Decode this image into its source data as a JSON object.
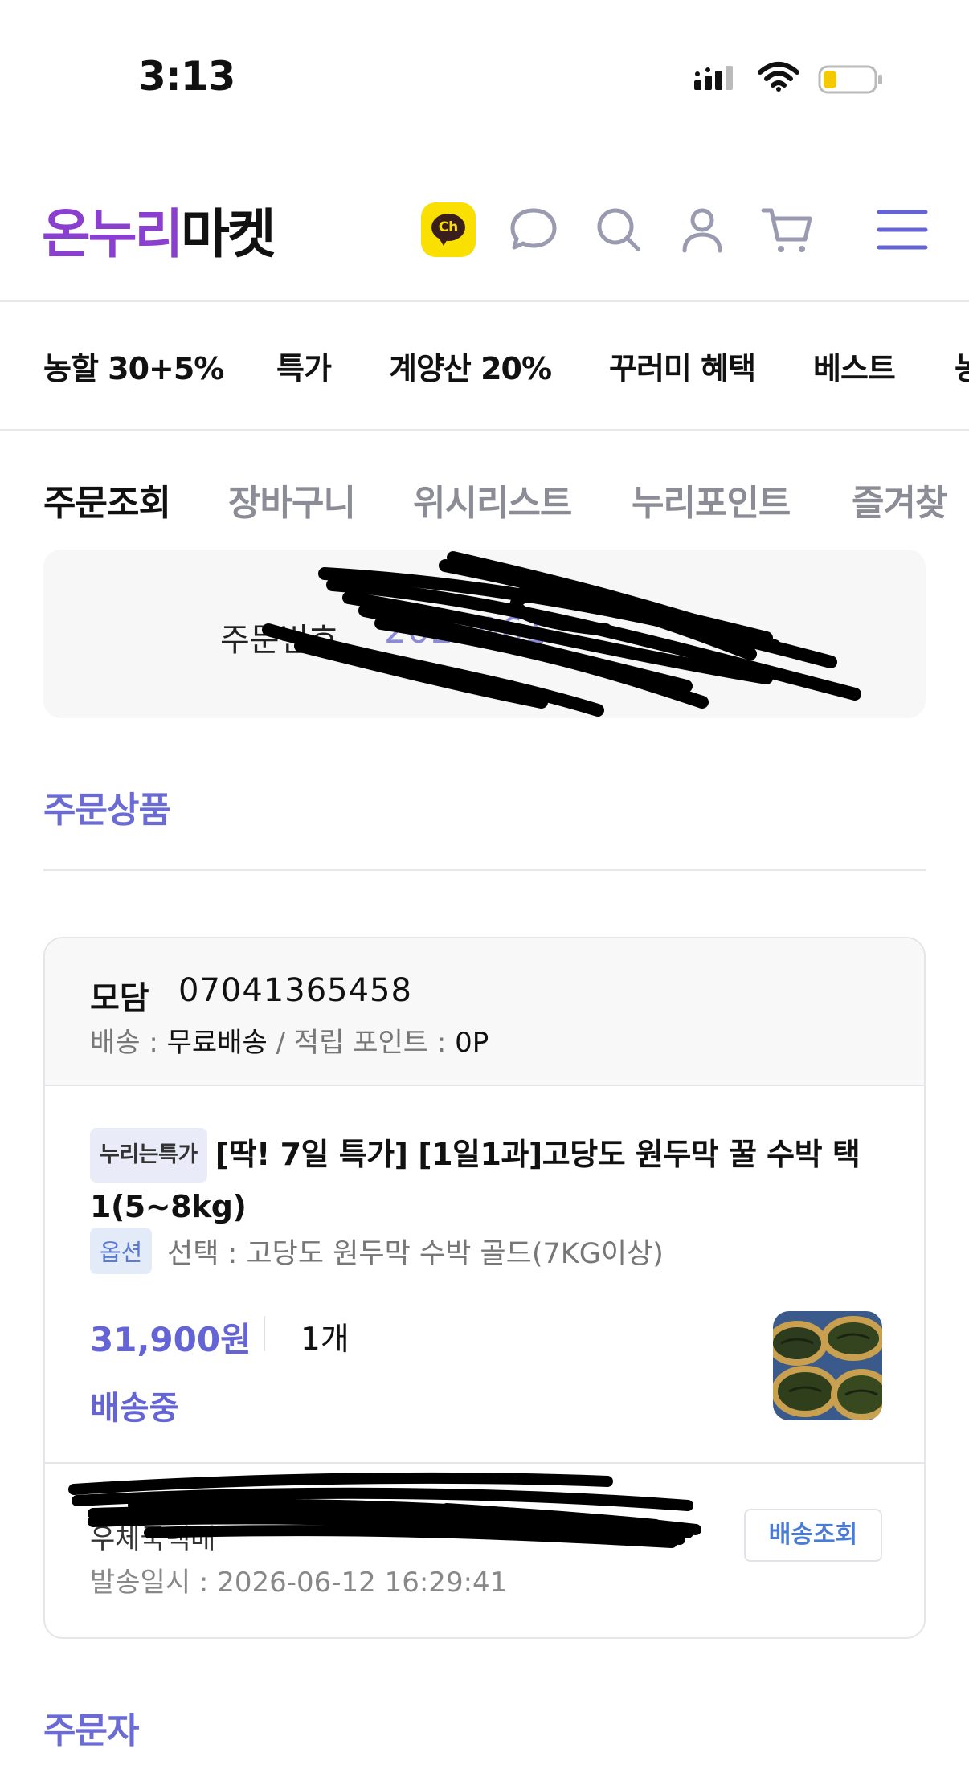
{
  "status_bar": {
    "time": "3:13"
  },
  "header": {
    "logo_part1": "온누리",
    "logo_part2": "마켓",
    "kakao_label": "Ch"
  },
  "promo_nav": [
    "농할 30+5%",
    "특가",
    "계양산 20%",
    "꾸러미 혜택",
    "베스트",
    "농"
  ],
  "tabs": [
    "주문조회",
    "장바구니",
    "위시리스트",
    "누리포인트",
    "즐겨찾"
  ],
  "order": {
    "label": "주문번호",
    "number": "2026061..."
  },
  "sections": {
    "products": "주문상품",
    "orderer": "주문자"
  },
  "product_card": {
    "seller": "모담",
    "seller_phone": "07041365458",
    "ship_label": "배송 : ",
    "ship_value": "무료배송",
    "point_label": " / 적립 포인트 : ",
    "point_value": "0P",
    "badge": "누리는특가",
    "title": "[딱! 7일 특가] [1일1과]고당도 원두막 꿀 수박 택1(5~8kg)",
    "option_badge": "옵션",
    "option_text": "선택 : 고당도 원두막 수박 골드(7KG이상)",
    "price": "31,900원",
    "quantity": "1개",
    "status": "배송중",
    "tracking": "우체국택배",
    "sent_date": "발송일시 : 2026-06-12 16:29:41",
    "track_button": "배송조회"
  },
  "colors": {
    "accent": "#6464d6",
    "logo_purple": "#8a3fd1",
    "kakao": "#f9e000"
  }
}
